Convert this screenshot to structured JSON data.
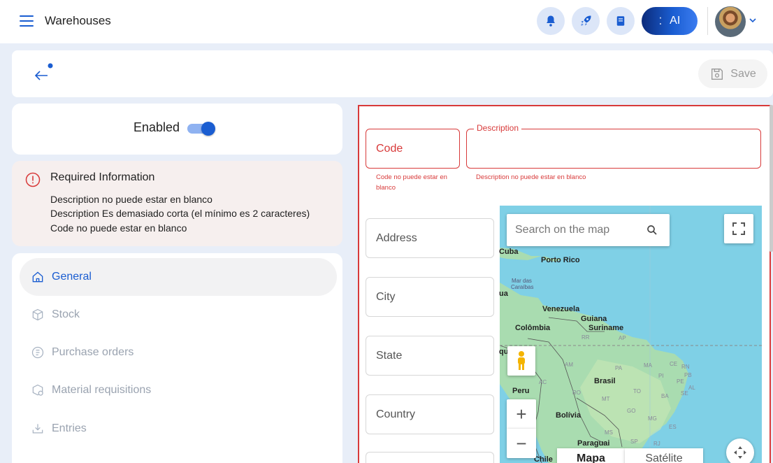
{
  "topbar": {
    "title": "Warehouses",
    "ai_label": "AI"
  },
  "toolbar": {
    "save_label": "Save"
  },
  "enabled": {
    "label": "Enabled",
    "value": true
  },
  "required": {
    "title": "Required Information",
    "messages": [
      "Description no puede estar en blanco",
      "Description Es demasiado corta (el mínimo es 2 caracteres)",
      "Code no puede estar en blanco"
    ]
  },
  "nav": {
    "items": [
      {
        "label": "General",
        "icon": "home-icon",
        "active": true
      },
      {
        "label": "Stock",
        "icon": "box-icon",
        "active": false
      },
      {
        "label": "Purchase orders",
        "icon": "purchase-order-icon",
        "active": false
      },
      {
        "label": "Material requisitions",
        "icon": "requisition-icon",
        "active": false
      },
      {
        "label": "Entries",
        "icon": "entries-icon",
        "active": false
      }
    ]
  },
  "form": {
    "code_placeholder": "Code",
    "code_error": "Code no puede estar en blanco",
    "description_legend": "Description",
    "description_error": "Description no puede estar en blanco",
    "address_placeholder": "Address",
    "city_placeholder": "City",
    "state_placeholder": "State",
    "country_placeholder": "Country"
  },
  "map": {
    "search_placeholder": "Search on the map",
    "type_map": "Mapa",
    "type_satellite": "Satélite",
    "labels": {
      "cuba": "Cuba",
      "porto_rico": "Porto Rico",
      "mar_das": "Mar das",
      "caraibas": "Caraíbas",
      "ua": "ua",
      "venezuela": "Venezuela",
      "guiana": "Guiana",
      "suriname": "Suriname",
      "colombia": "Colômbia",
      "rr": "RR",
      "ap": "AP",
      "am": "AM",
      "pa": "PA",
      "ma": "MA",
      "ce": "CE",
      "rn": "RN",
      "pb": "PB",
      "pi": "PI",
      "pe": "PE",
      "al": "AL",
      "se": "SE",
      "brasil": "Brasil",
      "ac": "AC",
      "ro": "RO",
      "to": "TO",
      "ba": "BA",
      "mt": "MT",
      "go": "GO",
      "mg": "MG",
      "es": "ES",
      "ms": "MS",
      "sp": "SP",
      "rj": "RJ",
      "peru": "Peru",
      "bolivia": "Bolívia",
      "paraguai": "Paraguai",
      "chile": "Chile",
      "qu": "qu"
    }
  },
  "colors": {
    "accent": "#1a5dd1",
    "error": "#d83a3a",
    "water": "#7fd0e6",
    "land": "#a9dcb0"
  }
}
